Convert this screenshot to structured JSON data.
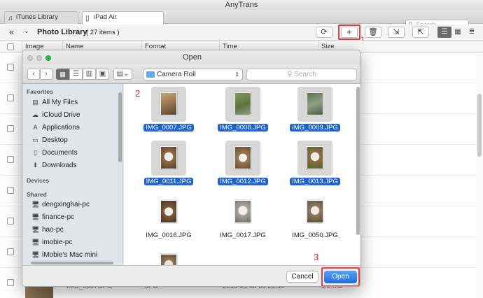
{
  "app": {
    "title": "AnyTrans"
  },
  "tabs": [
    {
      "label": "iTunes Library"
    },
    {
      "label": "iPad Air"
    }
  ],
  "top_search": {
    "placeholder": "Search"
  },
  "toolbar": {
    "section_title": "Photo Library",
    "item_count": "( 27 items )"
  },
  "columns": [
    "Image",
    "Name",
    "Format",
    "Time",
    "Size"
  ],
  "background_rows": [
    {
      "name": "IMG_0007.JPG",
      "format": "JPG",
      "time": "2015-04-08 09:23:40",
      "size": "1.2 MB"
    }
  ],
  "dialog": {
    "title": "Open",
    "location": "Camera Roll",
    "search_placeholder": "Search",
    "sidebar": {
      "favorites_title": "Favorites",
      "favorites": [
        {
          "label": "All My Files",
          "icon": "all-files-icon"
        },
        {
          "label": "iCloud Drive",
          "icon": "cloud-icon"
        },
        {
          "label": "Applications",
          "icon": "applications-icon"
        },
        {
          "label": "Desktop",
          "icon": "desktop-icon"
        },
        {
          "label": "Documents",
          "icon": "documents-icon"
        },
        {
          "label": "Downloads",
          "icon": "downloads-icon"
        }
      ],
      "devices_title": "Devices",
      "shared_title": "Shared",
      "shared": [
        {
          "label": "dengxinghai-pc"
        },
        {
          "label": "finance-pc"
        },
        {
          "label": "hao-pc"
        },
        {
          "label": "imobie-pc"
        },
        {
          "label": "iMobie's Mac mini"
        }
      ]
    },
    "files": [
      {
        "name": "IMG_0007.JPG",
        "selected": true
      },
      {
        "name": "IMG_0008.JPG",
        "selected": true
      },
      {
        "name": "IMG_0009.JPG",
        "selected": true
      },
      {
        "name": "IMG_0011.JPG",
        "selected": true
      },
      {
        "name": "IMG_0012.JPG",
        "selected": true
      },
      {
        "name": "IMG_0013.JPG",
        "selected": true
      },
      {
        "name": "IMG_0016.JPG",
        "selected": false
      },
      {
        "name": "IMG_0017.JPG",
        "selected": false
      },
      {
        "name": "IMG_0050.JPG",
        "selected": false
      }
    ],
    "cancel_label": "Cancel",
    "open_label": "Open"
  },
  "step_labels": {
    "one": "1",
    "two": "2",
    "three": "3"
  },
  "colors": {
    "selection": "#1e63d1",
    "annotation": "#e04040",
    "open_button": "#2f7ce8"
  }
}
